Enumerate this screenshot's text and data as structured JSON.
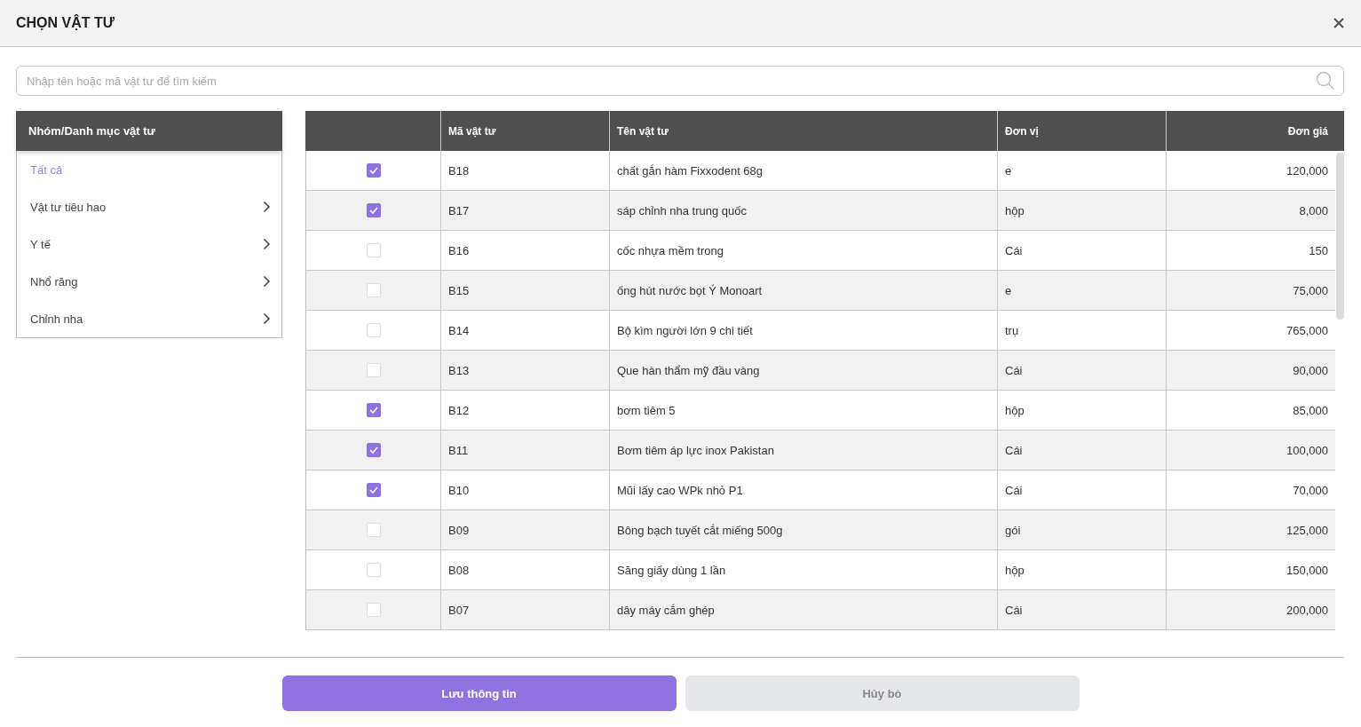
{
  "window": {
    "title": "CHỌN VẬT TƯ"
  },
  "search": {
    "placeholder": "Nhập tên hoặc mã vật tư để tìm kiếm"
  },
  "sidebar": {
    "title": "Nhóm/Danh mục vật tư",
    "items": [
      {
        "label": "Tất cả",
        "selected": true,
        "has_children": false
      },
      {
        "label": "Vật tư tiêu hao",
        "selected": false,
        "has_children": true
      },
      {
        "label": "Y tế",
        "selected": false,
        "has_children": true
      },
      {
        "label": "Nhổ răng",
        "selected": false,
        "has_children": true
      },
      {
        "label": "Chỉnh nha",
        "selected": false,
        "has_children": true
      }
    ]
  },
  "table": {
    "columns": [
      "Mã vật tư",
      "Tên vật tư",
      "Đơn vị",
      "Đơn giá"
    ],
    "rows": [
      {
        "checked": true,
        "code": "B18",
        "name": "chất gắn hàm Fixxodent 68g",
        "unit": "e",
        "price": "120,000"
      },
      {
        "checked": true,
        "code": "B17",
        "name": "sáp chỉnh nha trung quốc",
        "unit": "hộp",
        "price": "8,000"
      },
      {
        "checked": false,
        "code": "B16",
        "name": "cốc nhựa mềm trong",
        "unit": "Cái",
        "price": "150"
      },
      {
        "checked": false,
        "code": "B15",
        "name": "ống hút nước bọt Ý Monoart",
        "unit": "e",
        "price": "75,000"
      },
      {
        "checked": false,
        "code": "B14",
        "name": "Bộ kìm người lớn 9 chi tiết",
        "unit": "trụ",
        "price": "765,000"
      },
      {
        "checked": false,
        "code": "B13",
        "name": "Que hàn thẩm mỹ đầu vàng",
        "unit": "Cái",
        "price": "90,000"
      },
      {
        "checked": true,
        "code": "B12",
        "name": "bơm tiêm 5",
        "unit": "hộp",
        "price": "85,000"
      },
      {
        "checked": true,
        "code": "B11",
        "name": "Bơm tiêm áp lực inox Pakistan",
        "unit": "Cái",
        "price": "100,000"
      },
      {
        "checked": true,
        "code": "B10",
        "name": "Mũi lấy cao WPk nhỏ P1",
        "unit": "Cái",
        "price": "70,000"
      },
      {
        "checked": false,
        "code": "B09",
        "name": "Bông bạch tuyết cắt miếng 500g",
        "unit": "gói",
        "price": "125,000"
      },
      {
        "checked": false,
        "code": "B08",
        "name": "Săng giấy dùng 1 lần",
        "unit": "hộp",
        "price": "150,000"
      },
      {
        "checked": false,
        "code": "B07",
        "name": "dây máy cắm ghép",
        "unit": "Cái",
        "price": "200,000"
      }
    ]
  },
  "buttons": [
    {
      "label": "Lưu thông tin",
      "kind": "primary"
    },
    {
      "label": "Hủy bỏ",
      "kind": "secondary"
    }
  ]
}
